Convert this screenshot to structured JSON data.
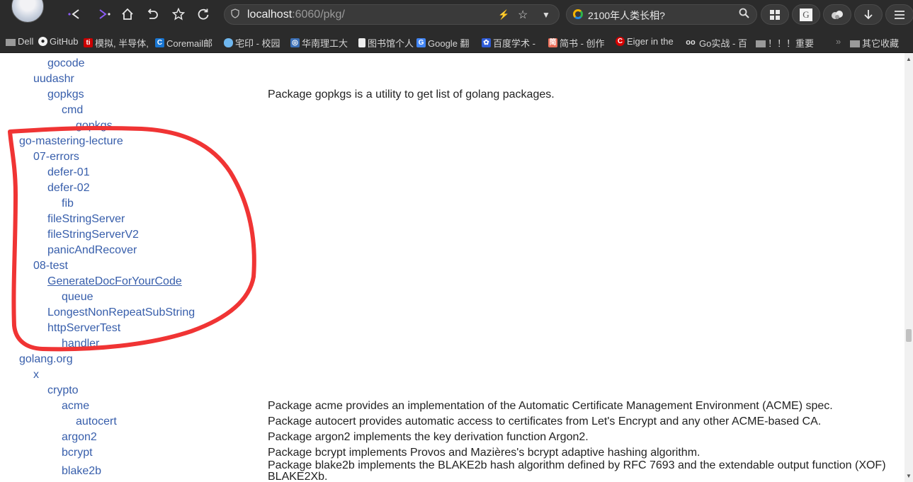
{
  "toolbar": {
    "url_host": "localhost",
    "url_rest": ":6060/pkg/",
    "search_text": "2100年人类长相?"
  },
  "bookmarks": [
    {
      "label": "Dell",
      "icon": "folder-icon"
    },
    {
      "label": "GitHub",
      "icon": "github-icon"
    },
    {
      "label": "模拟, 半导体,",
      "icon": "ti-icon"
    },
    {
      "label": "Coremail邮",
      "icon": "coremail-icon"
    },
    {
      "label": "宅印 - 校园",
      "icon": "cloud-icon"
    },
    {
      "label": "华南理工大",
      "icon": "scut-icon"
    },
    {
      "label": "图书馆个人",
      "icon": "document-icon"
    },
    {
      "label": "Google 翻",
      "icon": "google-translate-icon"
    },
    {
      "label": "百度学术 -",
      "icon": "baidu-icon"
    },
    {
      "label": "简书 - 创作",
      "icon": "jianshu-icon"
    },
    {
      "label": "Eiger in the",
      "icon": "c-logo-icon"
    },
    {
      "label": "Go实战 - 百",
      "icon": "goggles-icon"
    },
    {
      "label": "！！！重要",
      "icon": "folder-icon"
    },
    {
      "label": "其它收藏",
      "icon": "folder-icon"
    }
  ],
  "bookmarks_overflow": "»",
  "packages": [
    {
      "name": "gocode",
      "level": 2,
      "synopsis": ""
    },
    {
      "name": "uudashr",
      "level": 1,
      "synopsis": ""
    },
    {
      "name": "gopkgs",
      "level": 2,
      "synopsis": "Package gopkgs is a utility to get list of golang packages."
    },
    {
      "name": "cmd",
      "level": 3,
      "synopsis": ""
    },
    {
      "name": "gopkgs",
      "level": 4,
      "synopsis": ""
    },
    {
      "name": "go-mastering-lecture",
      "level": 0,
      "synopsis": ""
    },
    {
      "name": "07-errors",
      "level": 1,
      "synopsis": ""
    },
    {
      "name": "defer-01",
      "level": 2,
      "synopsis": ""
    },
    {
      "name": "defer-02",
      "level": 2,
      "synopsis": ""
    },
    {
      "name": "fib",
      "level": 3,
      "synopsis": ""
    },
    {
      "name": "fileStringServer",
      "level": 2,
      "synopsis": ""
    },
    {
      "name": "fileStringServerV2",
      "level": 2,
      "synopsis": ""
    },
    {
      "name": "panicAndRecover",
      "level": 2,
      "synopsis": ""
    },
    {
      "name": "08-test",
      "level": 1,
      "synopsis": ""
    },
    {
      "name": "GenerateDocForYourCode",
      "level": 2,
      "synopsis": "",
      "hovered": true
    },
    {
      "name": "queue",
      "level": 3,
      "synopsis": ""
    },
    {
      "name": "LongestNonRepeatSubString",
      "level": 2,
      "synopsis": ""
    },
    {
      "name": "httpServerTest",
      "level": 2,
      "synopsis": ""
    },
    {
      "name": "handler",
      "level": 3,
      "synopsis": ""
    },
    {
      "name": "golang.org",
      "level": 0,
      "synopsis": ""
    },
    {
      "name": "x",
      "level": 1,
      "synopsis": ""
    },
    {
      "name": "crypto",
      "level": 2,
      "synopsis": ""
    },
    {
      "name": "acme",
      "level": 3,
      "synopsis": "Package acme provides an implementation of the Automatic Certificate Management Environment (ACME) spec."
    },
    {
      "name": "autocert",
      "level": 4,
      "synopsis": "Package autocert provides automatic access to certificates from Let's Encrypt and any other ACME-based CA."
    },
    {
      "name": "argon2",
      "level": 3,
      "synopsis": "Package argon2 implements the key derivation function Argon2."
    },
    {
      "name": "bcrypt",
      "level": 3,
      "synopsis": "Package bcrypt implements Provos and Mazières's bcrypt adaptive hashing algorithm."
    },
    {
      "name": "blake2b",
      "level": 3,
      "synopsis": "Package blake2b implements the BLAKE2b hash algorithm defined by RFC 7693 and the extendable output function (XOF)",
      "synopsis_cont": "BLAKE2Xb."
    }
  ],
  "annotation_color": "#f03434",
  "link_color": "#375eab"
}
